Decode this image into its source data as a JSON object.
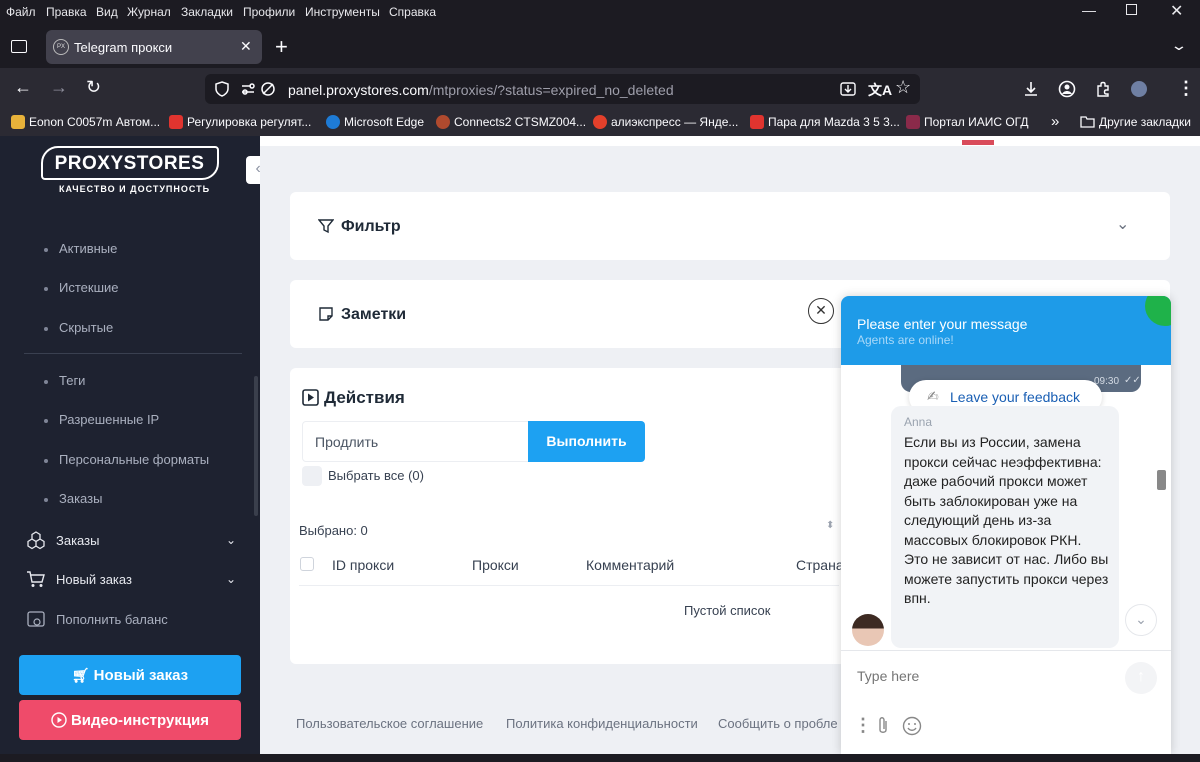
{
  "browser": {
    "menu": [
      "Файл",
      "Правка",
      "Вид",
      "Журнал",
      "Закладки",
      "Профили",
      "Инструменты",
      "Справка"
    ],
    "tab_title": "Telegram прокси",
    "tab_favicon": "PX",
    "url_domain": "panel.proxystores.com",
    "url_path": "/mtproxies/?status=expired_no_deleted",
    "bookmarks": [
      "Eonon C0057m Автом...",
      "Регулировка регулят...",
      "Microsoft Edge",
      "Connects2 CTSMZ004...",
      "алиэкспресс — Янде...",
      "Пара для Mazda 3 5 3...",
      "Портал ИАИС ОГД"
    ],
    "other_bookmarks": "Другие закладки",
    "colors": {
      "accent": "#1da1f2",
      "frame": "#1c1b22"
    }
  },
  "sidebar": {
    "logo_text": "PROXYSTORES",
    "logo_tagline": "КАЧЕСТВО И ДОСТУПНОСТЬ",
    "sub_items": [
      "Активные",
      "Истекшие",
      "Скрытые",
      "Теги",
      "Разрешенные IP",
      "Персональные форматы",
      "Заказы"
    ],
    "orders": "Заказы",
    "new_order": "Новый заказ",
    "top_up": "Пополнить баланс",
    "new_order_button": "Новый заказ",
    "video_button": "Видео-инструкция"
  },
  "main": {
    "filter_title": "Фильтр",
    "notes_title": "Заметки",
    "actions_title": "Действия",
    "action_select_value": "Продлить",
    "execute_button": "Выполнить",
    "select_all": "Выбрать все (0)",
    "selected": "Выбрано: 0",
    "columns": [
      "ID прокси",
      "Прокси",
      "Комментарий",
      "Страна"
    ],
    "empty": "Пустой список",
    "footer": [
      "Пользовательское соглашение",
      "Политика конфиденциальности",
      "Сообщить о пробле"
    ]
  },
  "chat": {
    "header_title": "Please enter your message",
    "header_subtitle": "Agents are online!",
    "msg_time": "09:30",
    "feedback": "Leave your feedback",
    "agent_name": "Anna",
    "message": "Если вы из России, замена прокси сейчас неэффективна: даже рабочий прокси может быть заблокирован уже на следующий день из-за массовых блокировок РКН. Это не зависит от нас. Либо вы можете запустить прокси через впн.",
    "input_placeholder": "Type here",
    "colors": {
      "header": "#1e9be8",
      "online": "#1fb24a"
    }
  }
}
